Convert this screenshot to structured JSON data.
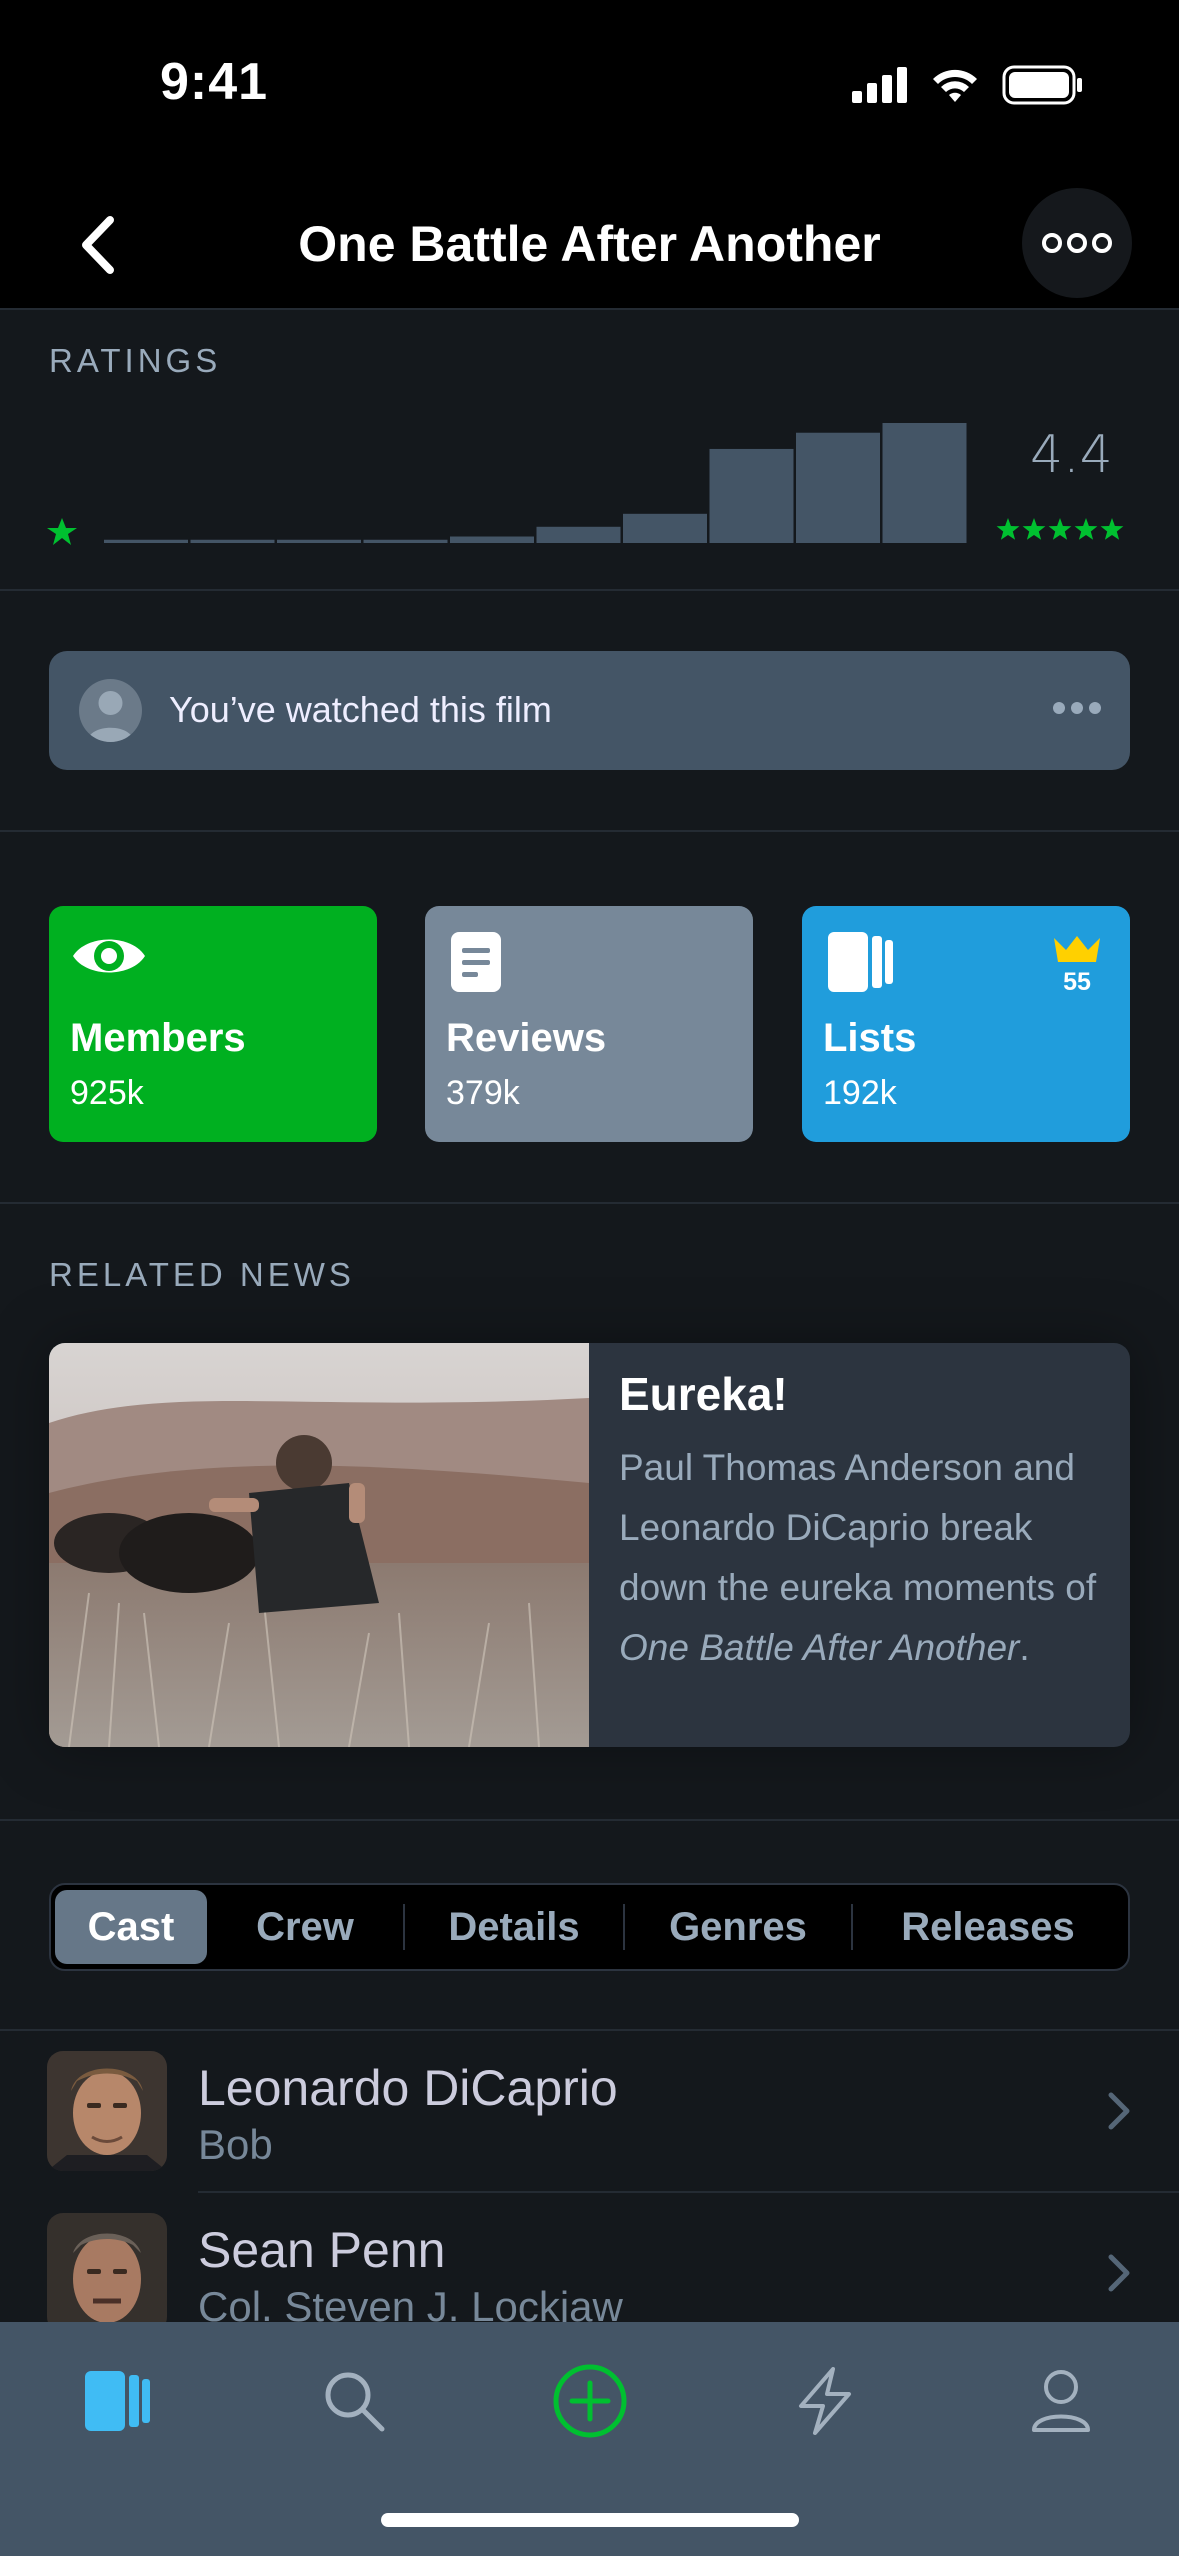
{
  "status_bar": {
    "time": "9:41"
  },
  "nav": {
    "title": "One Battle After Another"
  },
  "ratings": {
    "label": "RATINGS",
    "average": "4.4",
    "histogram": [
      1,
      1,
      1,
      1,
      2,
      5,
      9,
      29,
      34,
      37
    ],
    "colors": {
      "bar": "#445566",
      "star": "#00c030"
    }
  },
  "watched": {
    "text": "You’ve watched this film"
  },
  "stats": {
    "members": {
      "label": "Members",
      "value": "925k"
    },
    "reviews": {
      "label": "Reviews",
      "value": "379k"
    },
    "lists": {
      "label": "Lists",
      "value": "192k",
      "crown_count": "55"
    }
  },
  "news": {
    "label": "RELATED NEWS",
    "title": "Eureka!",
    "body_prefix": "Paul Thomas Anderson and Leonardo DiCaprio break down the eureka moments of ",
    "body_italic": "One Battle After Another",
    "body_suffix": "."
  },
  "tabs": [
    "Cast",
    "Crew",
    "Details",
    "Genres",
    "Releases"
  ],
  "active_tab": "Cast",
  "cast": [
    {
      "name": "Leonardo DiCaprio",
      "role": "Bob"
    },
    {
      "name": "Sean Penn",
      "role": "Col. Steven J. Lockjaw"
    }
  ],
  "tabbar": {
    "items": [
      "films-icon",
      "search-icon",
      "add-icon",
      "activity-icon",
      "profile-icon"
    ],
    "accent_green": "#00c030",
    "accent_blue": "#40bcf4"
  }
}
